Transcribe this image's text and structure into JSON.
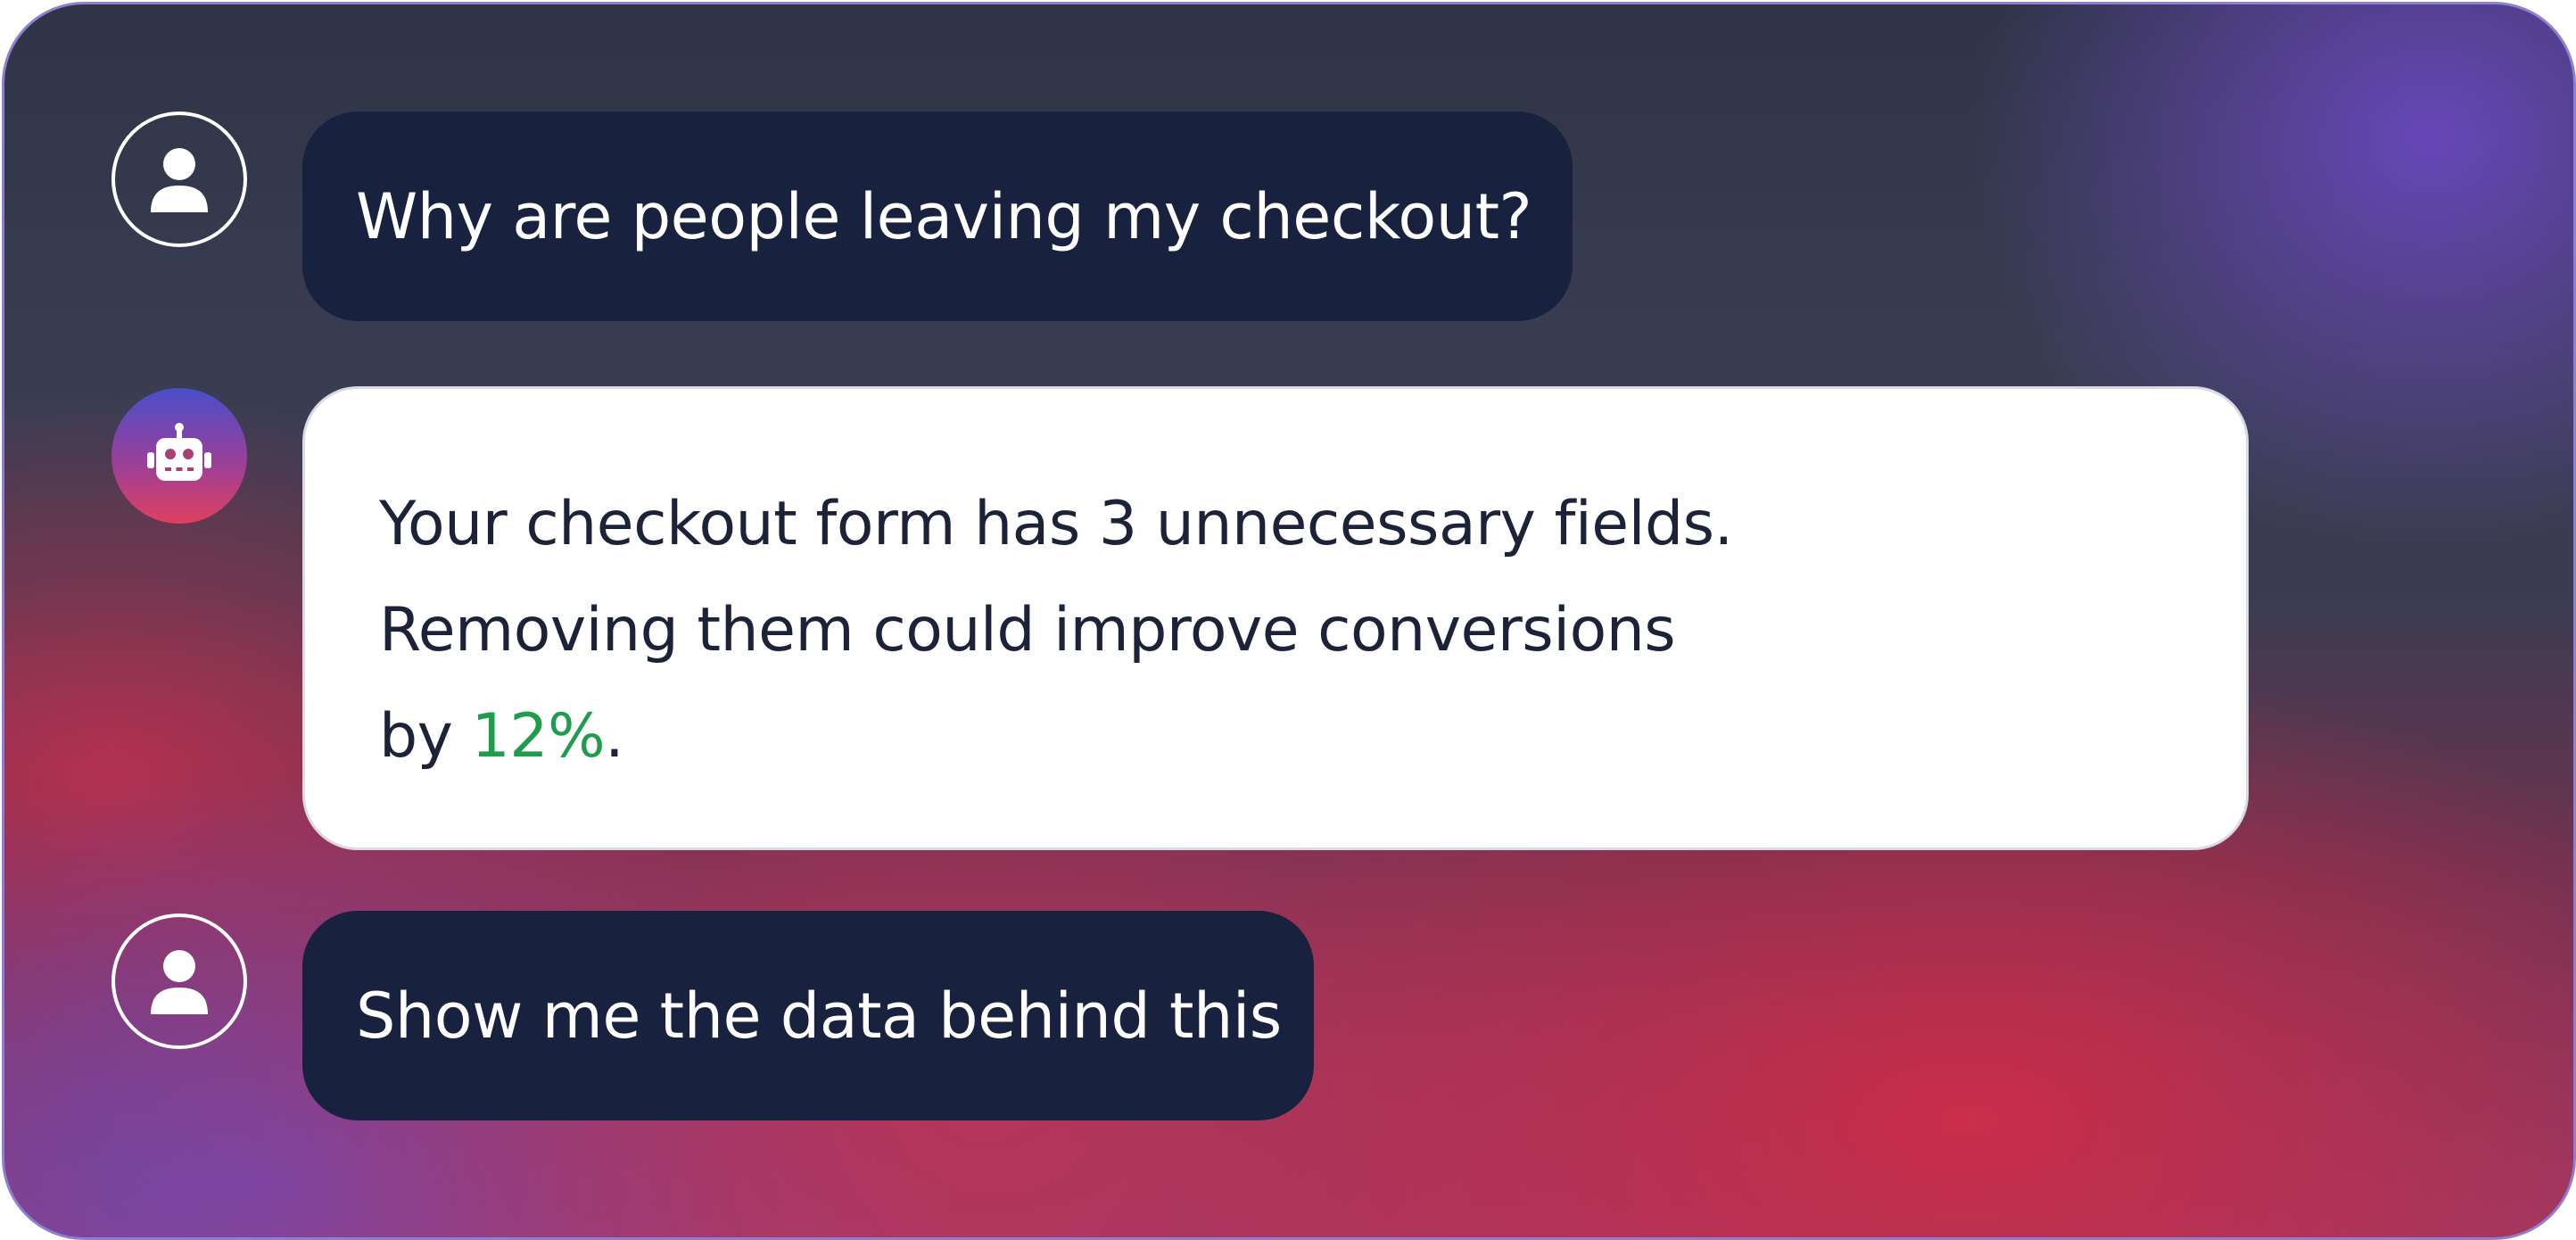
{
  "conversation": {
    "messages": [
      {
        "role": "user",
        "avatar_icon": "user-icon",
        "text": "Why are people leaving my checkout?"
      },
      {
        "role": "assistant",
        "avatar_icon": "robot-icon",
        "lines": [
          "Your checkout form has 3 unnecessary fields.",
          "Removing them could improve conversions"
        ],
        "last_line_prefix": "by ",
        "highlight_value": "12%",
        "last_line_suffix": "."
      },
      {
        "role": "user",
        "avatar_icon": "user-icon",
        "text": "Show me the data behind this"
      }
    ]
  },
  "colors": {
    "user_bubble": "#18213d",
    "assistant_bubble": "#ffffff",
    "highlight": "#1f9d4c",
    "panel_border": "#8e7fd0"
  }
}
